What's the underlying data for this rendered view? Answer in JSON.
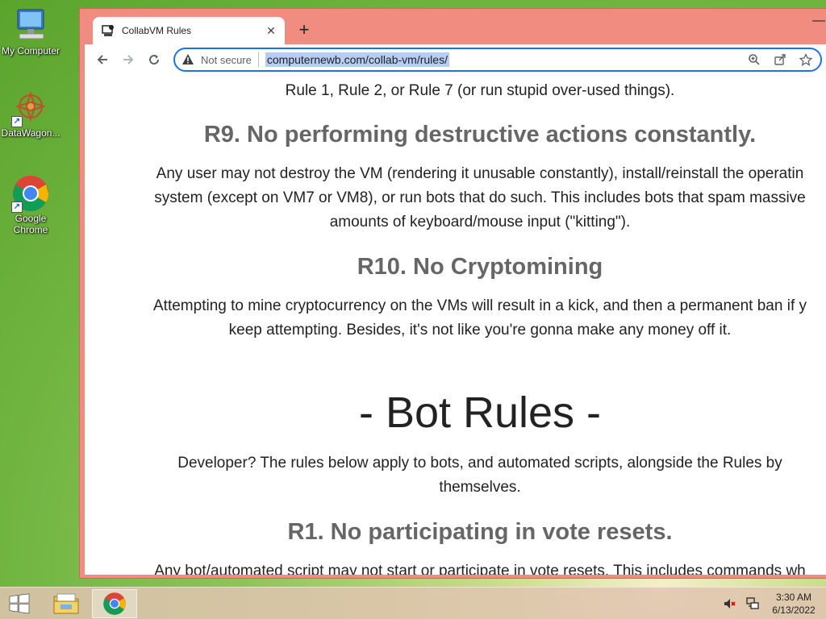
{
  "desktop": {
    "icons": [
      {
        "label": "My Computer"
      },
      {
        "label": "DataWagon..."
      },
      {
        "label": "Google Chrome"
      }
    ]
  },
  "browser": {
    "tab_title": "CollabVM Rules",
    "security_label": "Not secure",
    "url": "computernewb.com/collab-vm/rules/"
  },
  "page": {
    "partial_line": "Rule 1, Rule 2, or Rule 7 (or run stupid over-used things).",
    "r9_heading": "R9. No performing destructive actions constantly.",
    "r9_line1": "Any user may not destroy the VM (rendering it unusable constantly), install/reinstall the operatin",
    "r9_line2": "system (except on VM7 or VM8), or run bots that do such. This includes bots that spam massive",
    "r9_line3": "amounts of keyboard/mouse input (\"kitting\").",
    "r10_heading": "R10. No Cryptomining",
    "r10_line1": "Attempting to mine cryptocurrency on the VMs will result in a kick, and then a permanent ban if y",
    "r10_line2": "keep attempting. Besides, it's not like you're gonna make any money off it.",
    "bot_heading": "- Bot Rules -",
    "bot_intro_line1": "Developer? The rules below apply to bots, and automated scripts, alongside the Rules by",
    "bot_intro_line2": "themselves.",
    "b1_heading": "R1. No participating in vote resets.",
    "b1_line1": "Any bot/automated script may not start or participate in vote resets. This includes commands wh"
  },
  "taskbar": {
    "time": "3:30 AM",
    "date": "6/13/2022"
  }
}
